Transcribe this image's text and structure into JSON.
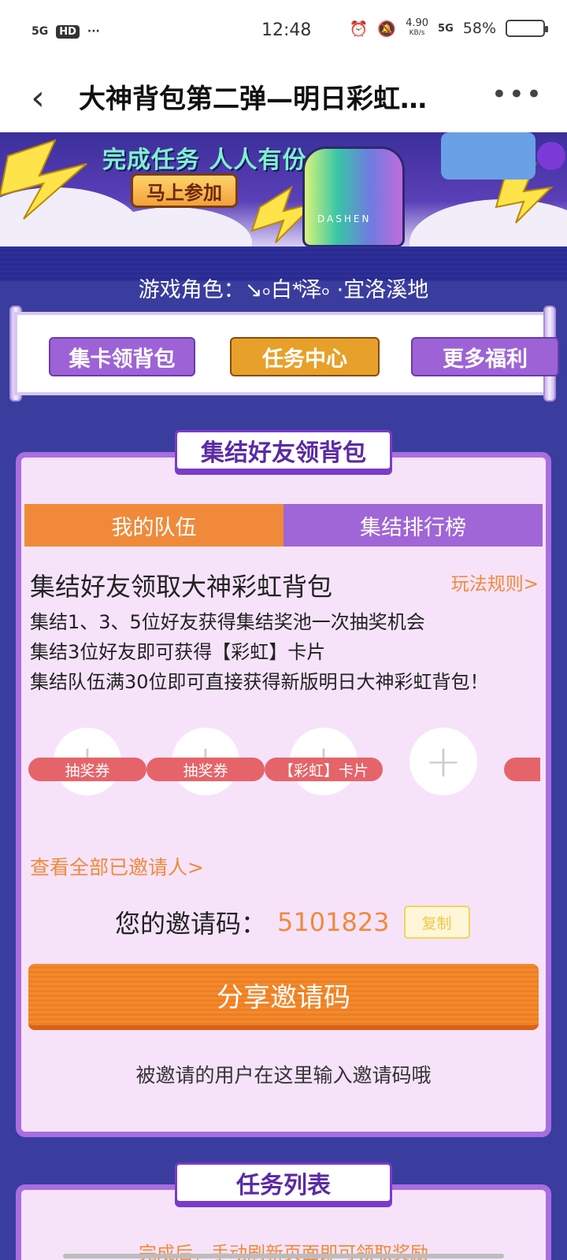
{
  "status_bar": {
    "network_left": "5G",
    "hd_label": "HD",
    "dots": "···",
    "time": "12:48",
    "speed_value": "4.90",
    "speed_unit": "KB/s",
    "network_right": "5G",
    "battery_text": "58%",
    "battery_level": 0.58
  },
  "title_bar": {
    "back_symbol": "‹",
    "title": "大神背包第二弹—明日彩虹…",
    "more_symbol": "•••"
  },
  "banner": {
    "slogan": "完成任务 人人有份",
    "join_label": "马上参加",
    "bag_text": "DASHEN"
  },
  "role_line": "游戏角色：↘৹白*ͥ泽৹ ·宜洛溪地",
  "nav": {
    "items": [
      "集卡领背包",
      "任务中心",
      "更多福利"
    ]
  },
  "section_title": "集结好友领背包",
  "tabs": [
    {
      "label": "我的队伍",
      "active": true
    },
    {
      "label": "集结排行榜",
      "active": false
    }
  ],
  "headline": "集结好友领取大神彩虹背包",
  "rules_link": "玩法规则>",
  "descriptions": [
    "集结1、3、5位好友获得集结奖池一次抽奖机会",
    "集结3位好友即可获得【彩虹】卡片",
    "集结队伍满30位即可直接获得新版明日大神彩虹背包！"
  ],
  "slots": {
    "plus": "+",
    "tags": [
      "抽奖券",
      "抽奖券",
      "【彩虹】卡片"
    ]
  },
  "view_all_link": "查看全部已邀请人>",
  "invite": {
    "label": "您的邀请码：",
    "code": "5101823",
    "copy_label": "复制"
  },
  "share_button": "分享邀请码",
  "hint": "被邀请的用户在这里输入邀请码哦",
  "task_section_title": "任务列表",
  "refresh_note": "完成后，手动刷新页面即可领取奖励"
}
